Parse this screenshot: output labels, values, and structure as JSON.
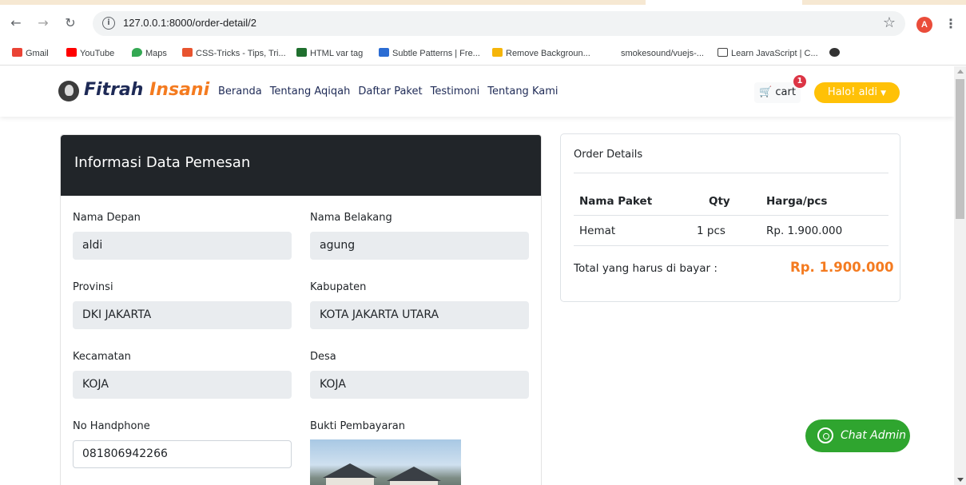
{
  "browser": {
    "url": "127.0.0.1:8000/order-detail/2",
    "profile_initial": "A",
    "bookmarks": [
      {
        "label": "Gmail",
        "color": "#ea4335"
      },
      {
        "label": "YouTube",
        "color": "#ff0000"
      },
      {
        "label": "Maps",
        "color": "#34a853"
      },
      {
        "label": "CSS-Tricks - Tips, Tri...",
        "color": "#e8542f"
      },
      {
        "label": "HTML var tag",
        "color": "#1f6f2e"
      },
      {
        "label": "Subtle Patterns | Fre...",
        "color": "#2b6cd3"
      },
      {
        "label": "Remove Backgroun...",
        "color": "#f5b50a"
      },
      {
        "label": "smokesound/vuejs-...",
        "color": "#ffffff"
      },
      {
        "label": "Learn JavaScript | C...",
        "color": "#444444"
      },
      {
        "label": "",
        "color": "#333333"
      }
    ]
  },
  "navbar": {
    "brand_part1": "Fitrah",
    "brand_part2": "Insani",
    "links": [
      "Beranda",
      "Tentang Aqiqah",
      "Daftar Paket",
      "Testimoni",
      "Tentang Kami"
    ],
    "cart_label": "cart",
    "cart_count": "1",
    "user_label": "Halo! aldi"
  },
  "order_form": {
    "title": "Informasi Data Pemesan",
    "fields": {
      "nama_depan": {
        "label": "Nama Depan",
        "value": "aldi"
      },
      "nama_belakang": {
        "label": "Nama Belakang",
        "value": "agung"
      },
      "provinsi": {
        "label": "Provinsi",
        "value": "DKI JAKARTA"
      },
      "kabupaten": {
        "label": "Kabupaten",
        "value": "KOTA JAKARTA UTARA"
      },
      "kecamatan": {
        "label": "Kecamatan",
        "value": "KOJA"
      },
      "desa": {
        "label": "Desa",
        "value": "KOJA"
      },
      "no_hp": {
        "label": "No Handphone",
        "value": "081806942266"
      },
      "bukti": {
        "label": "Bukti Pembayaran"
      }
    }
  },
  "order_details": {
    "title": "Order Details",
    "columns": [
      "Nama Paket",
      "Qty",
      "Harga/pcs"
    ],
    "rows": [
      [
        "Hemat",
        "1 pcs",
        "Rp. 1.900.000"
      ]
    ],
    "total_label": "Total yang harus di bayar :",
    "total_value": "Rp. 1.900.000"
  },
  "chat": {
    "label": "Chat Admin"
  },
  "colors": {
    "brand_navy": "#1e2a56",
    "accent_orange": "#f47b20",
    "user_yellow": "#ffc107",
    "chat_green": "#2fa52f"
  }
}
